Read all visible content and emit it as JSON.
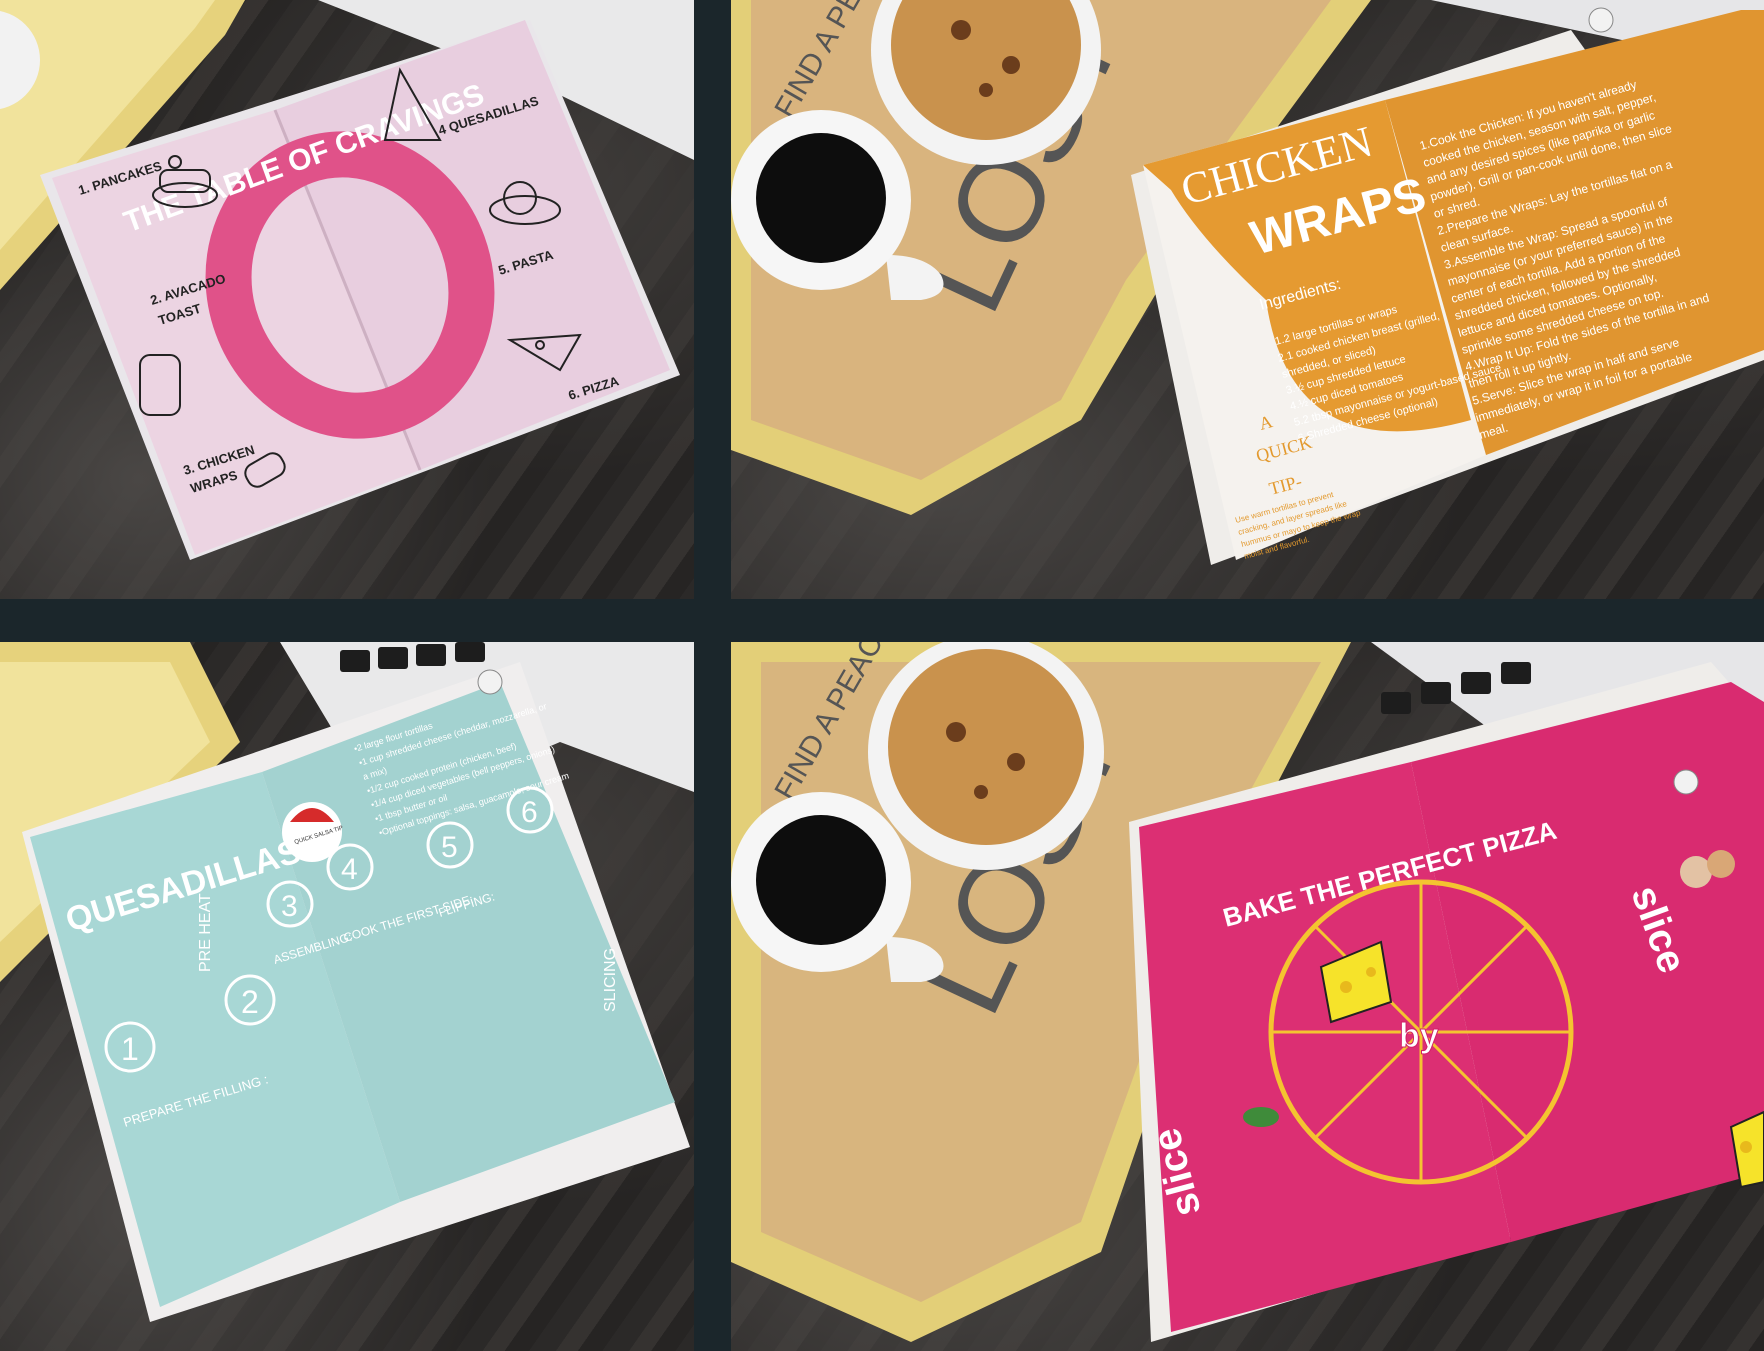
{
  "colors": {
    "background": "#1b262b",
    "toc_page": "#ecd3e3",
    "toc_ring": "#e04f86",
    "wrap_page": "#e0962f",
    "quesadilla_page": "#a9d8d6",
    "pizza_page": "#dc2f72",
    "tray": "#e3cf7a"
  },
  "toc": {
    "ring_text": "THE TABLE OF CRAVINGS",
    "items": [
      {
        "label": "1. PANCAKES"
      },
      {
        "label": "2. AVACADO"
      },
      {
        "label": "TOAST"
      },
      {
        "label": "3. CHICKEN"
      },
      {
        "label": "WRAPS"
      },
      {
        "label": "4 QUESADILLAS"
      },
      {
        "label": "5. PASTA"
      },
      {
        "label": "6. PIZZA"
      }
    ]
  },
  "wraps": {
    "title_line1": "CHICKEN",
    "title_line2": "WRAPS",
    "ingredients_heading": "Ingredients:",
    "ingredients": [
      "1.2 large tortillas or wraps",
      "2.1 cooked chicken breast (grilled,",
      "shredded, or sliced)",
      "3.½ cup shredded lettuce",
      "4.½ cup diced tomatoes",
      "5.2 tbsp mayonnaise or yogurt-based sauce",
      "6.Shredded cheese (optional)"
    ],
    "tip_line1": "A",
    "tip_line2": "QUICK",
    "tip_line3": "TIP-",
    "tip_body": [
      "Use warm tortillas to prevent",
      "cracking, and layer spreads like",
      "hummus or mayo to keep the wrap",
      "moist and flavorful."
    ],
    "steps": [
      "1.Cook the Chicken: If you haven't already",
      "cooked the chicken, season with salt, pepper,",
      "and any desired spices (like paprika or garlic",
      "powder). Grill or pan-cook until done, then slice",
      "or shred.",
      "2.Prepare the Wraps: Lay the tortillas flat on a",
      "clean surface.",
      "3.Assemble the Wrap: Spread a spoonful of",
      "mayonnaise (or your preferred sauce) in the",
      "center of each tortilla. Add a portion of the",
      "shredded chicken, followed by the shredded",
      "lettuce and diced tomatoes. Optionally,",
      "sprinkle some shredded cheese on top.",
      "4.Wrap It Up: Fold the sides of the tortilla in and",
      "then roll it up tightly.",
      "5.Serve: Slice the wrap in half and serve",
      "immediately, or wrap it in foil for a portable",
      "meal."
    ]
  },
  "quesadillas": {
    "title": "QUESADILLAS",
    "salsa_tip": "QUICK SALSA TIP",
    "ingredients": [
      "•2 large flour tortillas",
      "•1 cup shredded cheese (cheddar, mozzarella, or",
      "a mix)",
      "•1/2 cup cooked protein (chicken, beef)",
      "•1/4 cup diced vegetables (bell peppers, onions)",
      "•1 tbsp butter or oil",
      "•Optional toppings: salsa, guacamole, sour cream"
    ],
    "steps": [
      {
        "num": "1",
        "label": "PREPARE THE FILLING :"
      },
      {
        "num": "2",
        "label": ""
      },
      {
        "num": "3",
        "label": "ASSEMBLING:"
      },
      {
        "num": "4",
        "label": "COOK THE FIRST SIDE:"
      },
      {
        "num": "5",
        "label": "FLIPPING:"
      },
      {
        "num": "6",
        "label": ""
      }
    ],
    "preheat": "PRE HEAT",
    "slicing": "SLICING"
  },
  "pizza": {
    "title": "BAKE THE PERFECT PIZZA",
    "slice_top": "slice",
    "slice_bottom": "slice",
    "by": "by"
  },
  "tray": {
    "text_top": "FIND A PEACE",
    "text_big": "LOST"
  }
}
